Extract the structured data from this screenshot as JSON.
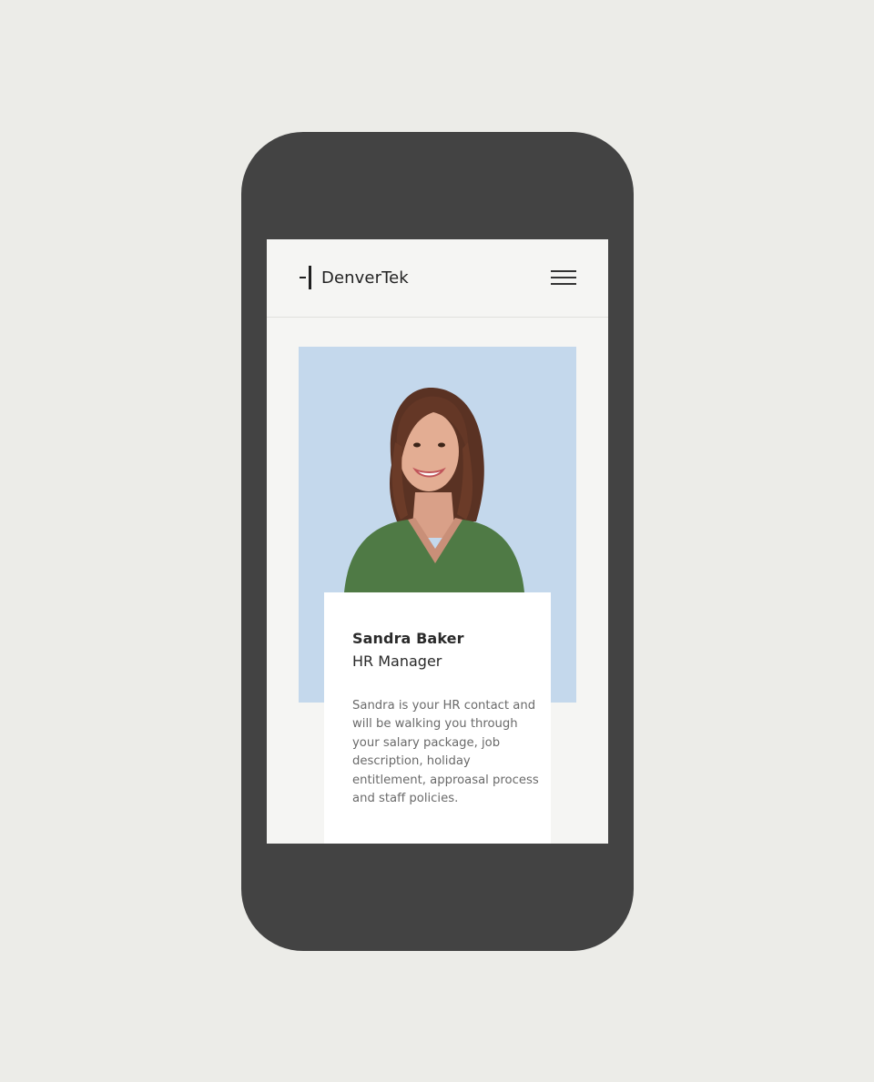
{
  "header": {
    "brand": "DenverTek",
    "logo_icon": "brand-mark-icon",
    "menu_icon": "hamburger-menu-icon"
  },
  "profile": {
    "photo_background": "#c4d8ec",
    "name": "Sandra Baker",
    "role": "HR Manager",
    "bio": "Sandra is your HR contact and will be walking you through your salary package, job description, holiday entitlement, approasal process and staff policies."
  },
  "colors": {
    "page_background": "#ecece8",
    "device_frame": "#434343",
    "screen_background": "#f5f5f3",
    "card_background": "#ffffff"
  }
}
